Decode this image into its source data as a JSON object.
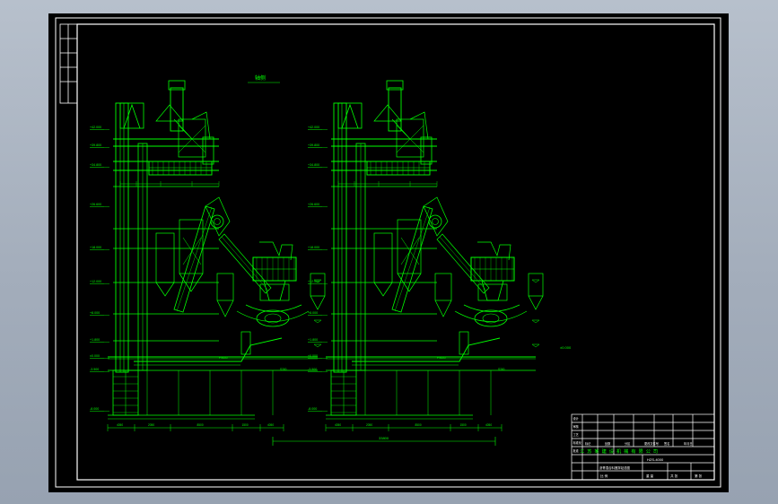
{
  "drawing": {
    "view_label": "轴侧",
    "overall_dimension": "33800",
    "level_labels": [
      "+42.000",
      "+39.800",
      "+34.800",
      "+26.600",
      "+18.000",
      "+12.000",
      "+8.000",
      "+1.800",
      "±0.000",
      "-3.500",
      "-8.000"
    ],
    "right_marker": "±0.000",
    "bottom_dimensions": [
      "4050",
      "2050",
      "8500",
      "1500",
      "4050"
    ],
    "callouts": [
      "PS600",
      "S300"
    ]
  },
  "title_block": {
    "company": "江苏某建设机械有限公司",
    "drawing_title": "沥青混合料搅拌站总图",
    "drawing_number": "HZS-4000",
    "scale_label": "比 例",
    "weight_label": "重 量",
    "rev_label": "共 张",
    "sheet_label": "第 张",
    "row_labels": [
      "标记",
      "处数",
      "分区",
      "更改文件号",
      "签名",
      "年月日"
    ],
    "role_labels": [
      "设计",
      "审核",
      "工艺",
      "标准化",
      "批准"
    ]
  },
  "colors": {
    "line": "#00ff00",
    "frame": "#ffffff",
    "background": "#000000"
  }
}
